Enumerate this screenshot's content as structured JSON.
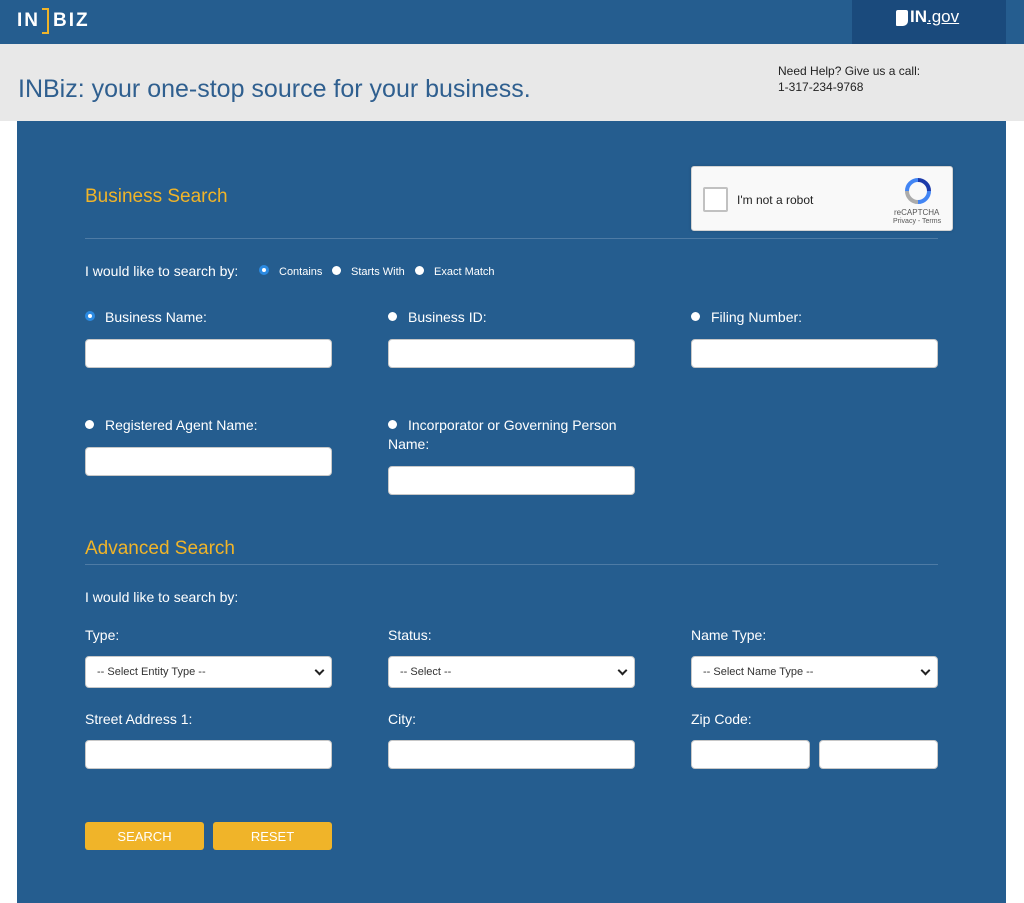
{
  "header": {
    "logo_left": "IN",
    "logo_right": "BIZ",
    "ingov_in": "IN",
    "ingov_gov": ".gov"
  },
  "banner": {
    "tagline": "INBiz: your one-stop source for your business.",
    "help_line1": "Need Help? Give us a call:",
    "help_line2": "1-317-234-9768"
  },
  "business_search": {
    "title": "Business Search",
    "search_by_label": "I would like to search by:",
    "match_options": [
      {
        "label": "Contains",
        "selected": true
      },
      {
        "label": "Starts With",
        "selected": false
      },
      {
        "label": "Exact Match",
        "selected": false
      }
    ],
    "fields": {
      "business_name": {
        "label": "Business Name:",
        "selected": true,
        "value": ""
      },
      "business_id": {
        "label": "Business ID:",
        "selected": false,
        "value": ""
      },
      "filing_number": {
        "label": "Filing Number:",
        "selected": false,
        "value": ""
      },
      "registered_agent": {
        "label": "Registered Agent Name:",
        "selected": false,
        "value": ""
      },
      "incorporator_line1": "Incorporator or Governing Person",
      "incorporator_line2": "Name:"
    }
  },
  "recaptcha": {
    "label": "I'm not a robot",
    "brand": "reCAPTCHA",
    "terms": "Privacy - Terms"
  },
  "advanced_search": {
    "title": "Advanced Search",
    "search_by_label": "I would like to search by:",
    "type_label": "Type:",
    "type_value": "-- Select Entity Type --",
    "status_label": "Status:",
    "status_value": "-- Select --",
    "name_type_label": "Name Type:",
    "name_type_value": "-- Select Name Type --",
    "street_label": "Street Address 1:",
    "city_label": "City:",
    "zip_label": "Zip Code:"
  },
  "buttons": {
    "search": "SEARCH",
    "reset": "RESET"
  },
  "colors": {
    "brand_blue": "#255d8f",
    "accent_gold": "#f0b429",
    "selected_radio": "#2b8ae2"
  },
  "icons": [
    "indiana-state-icon",
    "recaptcha-logo-icon",
    "chevron-down-icon"
  ]
}
